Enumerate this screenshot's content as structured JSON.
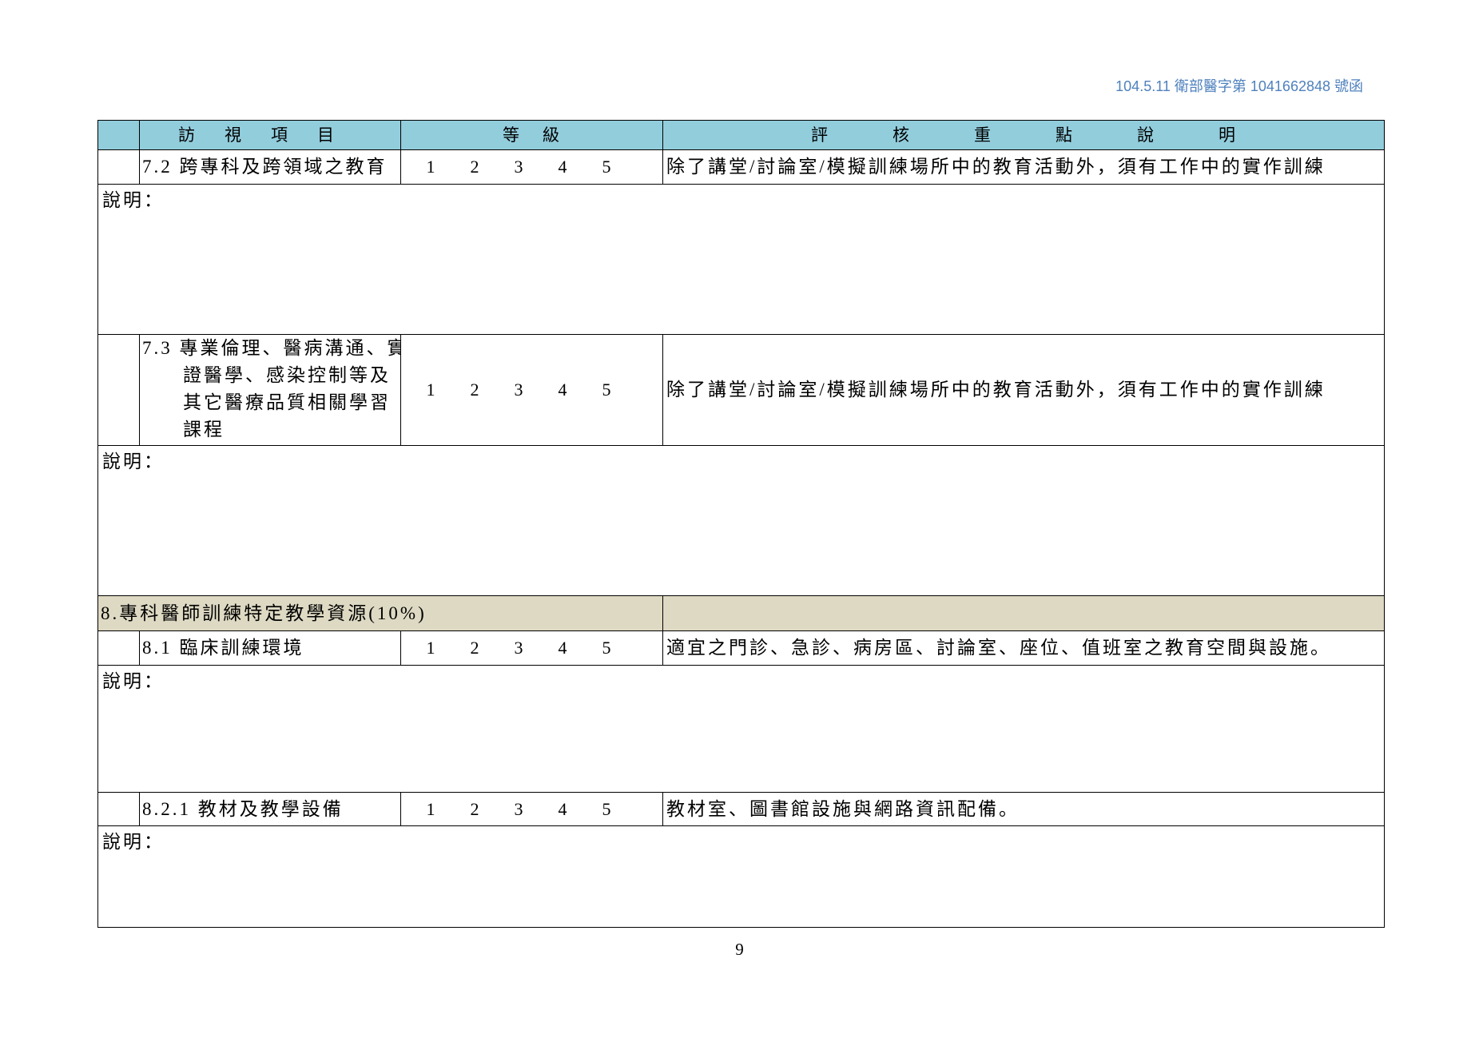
{
  "page": {
    "header_note": "104.5.11 衛部醫字第 1041662848 號函",
    "page_number": "9"
  },
  "colors": {
    "header_fill": "#92CDDC",
    "section_fill": "#DDD9C3",
    "header_note": "#4F81BD"
  },
  "table": {
    "headers": {
      "item": "訪視項目",
      "grade": "等級",
      "criteria": "評核重點說明"
    },
    "rows": [
      {
        "label": "7.2 跨專科及跨領域之教育",
        "grades": [
          "1",
          "2",
          "3",
          "4",
          "5"
        ],
        "criteria": "除了講堂/討論室/模擬訓練場所中的教育活動外，須有工作中的實作訓練",
        "note_label": "說明："
      },
      {
        "label_lines": [
          "7.3 專業倫理、醫病溝通、實",
          "證醫學、感染控制等及",
          "其它醫療品質相關學習",
          "課程"
        ],
        "grades": [
          "1",
          "2",
          "3",
          "4",
          "5"
        ],
        "criteria": "除了講堂/討論室/模擬訓練場所中的教育活動外，須有工作中的實作訓練",
        "note_label": "說明："
      },
      {
        "label": "8.1 臨床訓練環境",
        "grades": [
          "1",
          "2",
          "3",
          "4",
          "5"
        ],
        "criteria": "適宜之門診、急診、病房區、討論室、座位、值班室之教育空間與設施。",
        "note_label": "說明："
      },
      {
        "label": "8.2.1 教材及教學設備",
        "grades": [
          "1",
          "2",
          "3",
          "4",
          "5"
        ],
        "criteria": "教材室、圖書館設施與網路資訊配備。",
        "note_label": "說明："
      }
    ],
    "section_8": "8.專科醫師訓練特定教學資源(10%)"
  }
}
